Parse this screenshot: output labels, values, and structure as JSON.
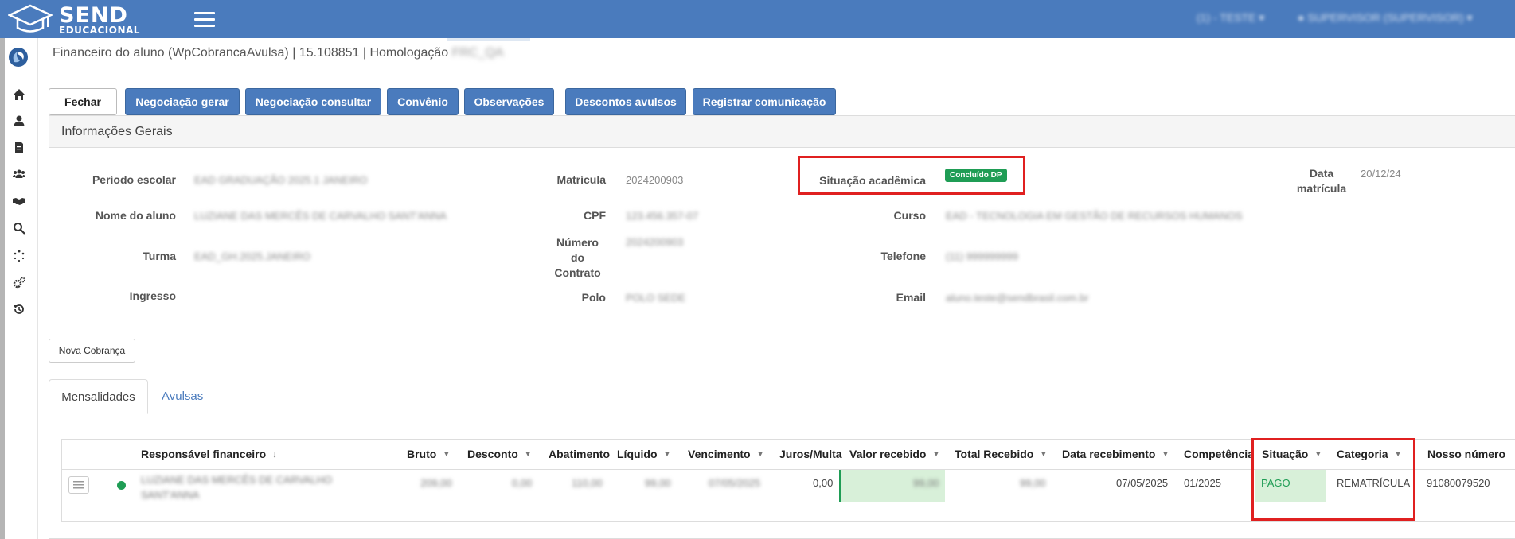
{
  "app": {
    "brand_main": "SEND",
    "brand_sub": "EDUCACIONAL",
    "unit_selector": "(1) - TESTE",
    "user_menu": "SUPERVISOR (SUPERVISOR)"
  },
  "breadcrumb": {
    "text": "Financeiro do aluno (WpCobrancaAvulsa) | 15.108851 | Homologação",
    "env": "FRC_QA"
  },
  "toolbar": {
    "close": "Fechar",
    "negociacao_gerar": "Negociação gerar",
    "negociacao_consultar": "Negociação consultar",
    "convenio": "Convênio",
    "observacoes": "Observações",
    "descontos_avulsos": "Descontos avulsos",
    "registrar_comunicacao": "Registrar comunicação"
  },
  "info": {
    "title": "Informações Gerais",
    "periodo_label": "Período escolar",
    "periodo_value": "EAD GRADUAÇÃO 2025.1 JANEIRO",
    "nome_label": "Nome do aluno",
    "nome_value": "LUZIANE DAS MERCÊS DE CARVALHO SANT'ANNA",
    "turma_label": "Turma",
    "turma_value": "EAD_GH.2025.JANEIRO",
    "ingresso_label": "Ingresso",
    "matricula_label": "Matrícula",
    "matricula_value": "2024200903",
    "cpf_label": "CPF",
    "cpf_value": "123.456.357-07",
    "contrato_label_1": "Número",
    "contrato_label_2": "do",
    "contrato_label_3": "Contrato",
    "contrato_value": "2024200903",
    "polo_label": "Polo",
    "polo_value": "POLO SEDE",
    "situacao_label": "Situação acadêmica",
    "situacao_badge": "Concluído DP",
    "curso_label": "Curso",
    "curso_value": "EAD - TECNOLOGIA EM GESTÃO DE RECURSOS HUMANOS",
    "telefone_label": "Telefone",
    "telefone_value": "(11) 999999999",
    "email_label": "Email",
    "email_value": "aluno.teste@sendbrasil.com.br",
    "data_matricula_label_1": "Data",
    "data_matricula_label_2": "matrícula",
    "data_matricula_value": "20/12/24"
  },
  "actions": {
    "nova_cobranca": "Nova Cobrança"
  },
  "tabs": {
    "mensalidades": "Mensalidades",
    "avulsas": "Avulsas"
  },
  "grid": {
    "columns": {
      "responsavel": "Responsável financeiro",
      "bruto": "Bruto",
      "desconto": "Desconto",
      "abatimento": "Abatimento",
      "liquido": "Líquido",
      "vencimento": "Vencimento",
      "juros": "Juros/Multa",
      "valor_recebido": "Valor recebido",
      "total_recebido": "Total Recebido",
      "data_recebimento": "Data recebimento",
      "competencia": "Competência",
      "situacao": "Situação",
      "categoria": "Categoria",
      "nosso_numero": "Nosso número"
    },
    "row": {
      "responsavel_1": "LUZIANE DAS MERCÊS DE CARVALHO",
      "responsavel_2": "SANT'ANNA",
      "bruto": "209,00",
      "desconto": "0,00",
      "abatimento": "110,00",
      "liquido": "99,00",
      "vencimento": "07/05/2025",
      "juros": "0,00",
      "valor_recebido": "99,00",
      "total_recebido": "99,00",
      "data_recebimento": "07/05/2025",
      "competencia": "01/2025",
      "situacao": "PAGO",
      "categoria": "REMATRÍCULA",
      "nosso_numero": "91080079520"
    }
  },
  "colors": {
    "primary": "#4a7bbd",
    "success": "#1f9d55",
    "highlight": "#e02020",
    "paid_bg": "#d8f0d9"
  },
  "icons": [
    "graduation-cap-icon",
    "menu-icon",
    "home-icon",
    "user-icon",
    "document-icon",
    "users-icon",
    "handshake-icon",
    "search-icon",
    "spinner-icon",
    "gears-icon",
    "history-icon",
    "list-icon",
    "sort-down-icon"
  ]
}
